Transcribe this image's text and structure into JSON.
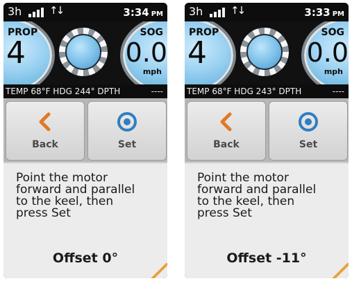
{
  "screens": [
    {
      "status": {
        "left": "3h",
        "time": "3:34",
        "ampm": "PM"
      },
      "gauges": {
        "prop_label": "PROP",
        "prop_value": "4",
        "sog_label": "SOG",
        "sog_value": "0.0",
        "sog_unit": "mph"
      },
      "info": {
        "left": "TEMP 68°F  HDG 244°  DPTH",
        "right": "----"
      },
      "buttons": {
        "back_label": "Back",
        "set_label": "Set"
      },
      "message": "Point the motor\nforward and parallel\nto the keel, then\npress Set",
      "offset": "Offset 0°"
    },
    {
      "status": {
        "left": "3h",
        "time": "3:33",
        "ampm": "PM"
      },
      "gauges": {
        "prop_label": "PROP",
        "prop_value": "4",
        "sog_label": "SOG",
        "sog_value": "0.0",
        "sog_unit": "mph"
      },
      "info": {
        "left": "TEMP 68°F  HDG 243°  DPTH",
        "right": "----"
      },
      "buttons": {
        "back_label": "Back",
        "set_label": "Set"
      },
      "message": "Point the motor\nforward and parallel\nto the keel, then\npress Set",
      "offset": "Offset -11°"
    }
  ],
  "icons": {
    "signal": "signal-bars-icon",
    "data": "data-arrows-icon",
    "back": "chevron-left-icon",
    "set": "target-icon"
  },
  "colors": {
    "accent_orange": "#e07a24",
    "set_blue": "#2f7ec1",
    "gauge_blue": "#6bb5e0"
  }
}
